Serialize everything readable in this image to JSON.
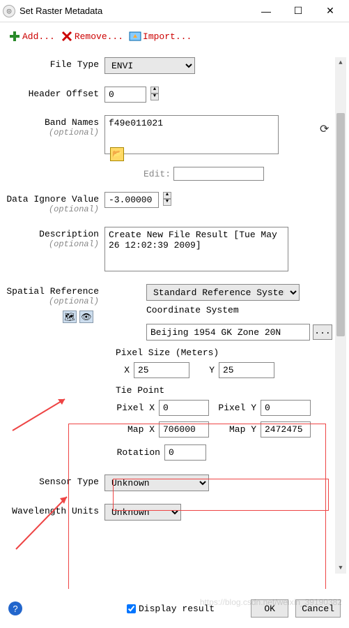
{
  "window": {
    "title": "Set Raster Metadata"
  },
  "toolbar": {
    "add": "Add...",
    "remove": "Remove...",
    "import": "Import..."
  },
  "labels": {
    "fileType": "File Type",
    "headerOffset": "Header Offset",
    "bandNames": "Band Names",
    "dataIgnore": "Data Ignore Value",
    "description": "Description",
    "spatialRef": "Spatial Reference",
    "coordSys": "Coordinate System",
    "pixelSize": "Pixel Size (Meters)",
    "tiePoint": "Tie Point",
    "rotation": "Rotation",
    "sensorType": "Sensor Type",
    "wavelength": "Wavelength Units",
    "optional": "(optional)",
    "edit": "Edit:",
    "x": "X",
    "y": "Y",
    "pixelX": "Pixel X",
    "pixelY": "Pixel Y",
    "mapX": "Map X",
    "mapY": "Map Y"
  },
  "values": {
    "fileType": "ENVI",
    "headerOffset": "0",
    "bandNames": "f49e011021",
    "dataIgnore": "-3.00000",
    "description": "Create New File Result [Tue May 26 12:02:39 2009]",
    "srMode": "Standard Reference System",
    "coordSys": "Beijing 1954 GK Zone 20N",
    "pixelX": "25",
    "pixelY": "25",
    "tiePX": "0",
    "tiePY": "0",
    "mapX": "706000",
    "mapY": "2472475",
    "rotation": "0",
    "sensorType": "Unknown",
    "wavelength": "Unknown"
  },
  "footer": {
    "displayResult": "Display result",
    "ok": "OK",
    "cancel": "Cancel"
  }
}
